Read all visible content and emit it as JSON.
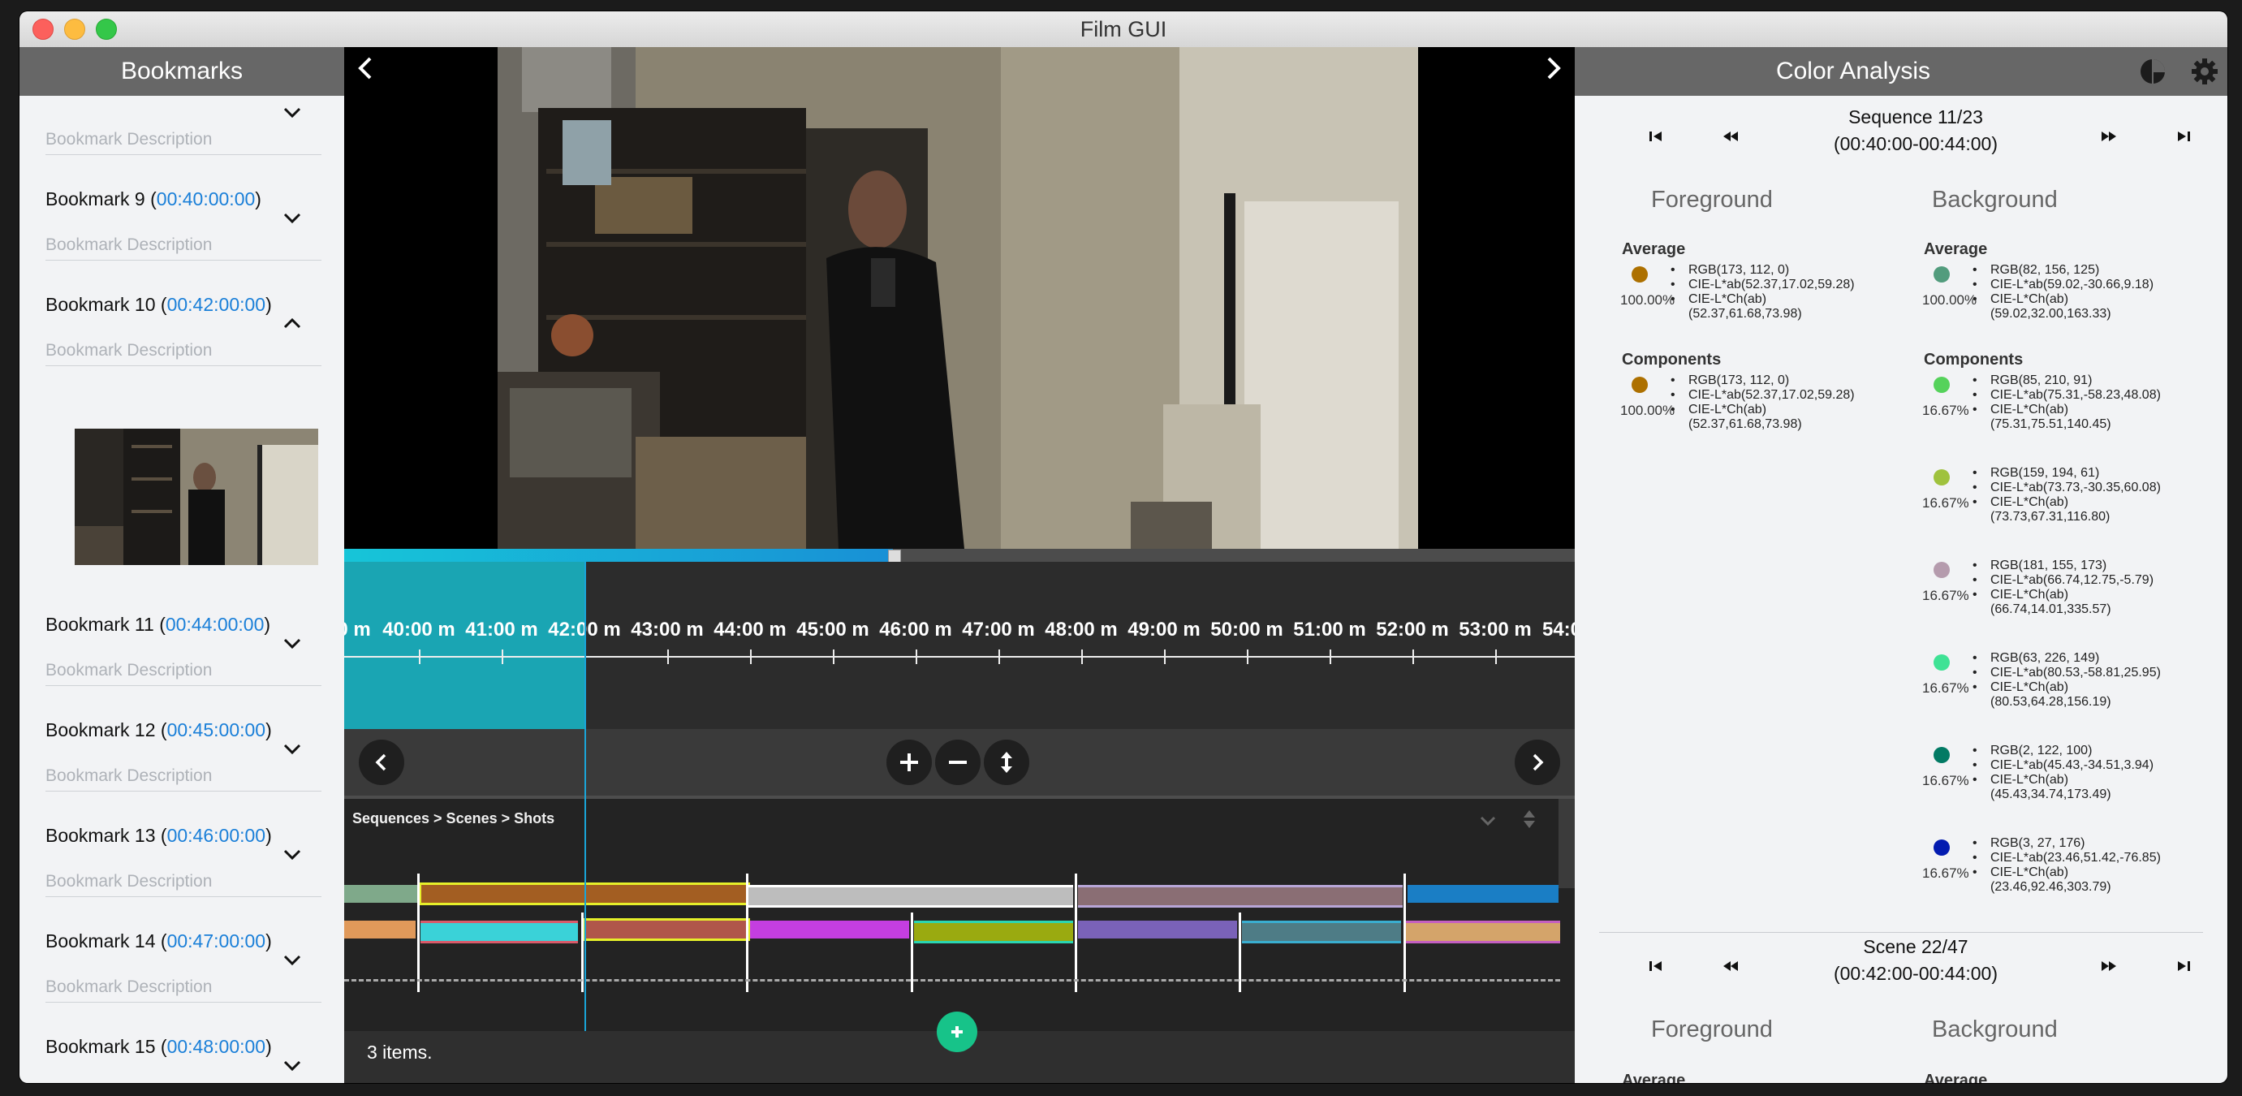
{
  "window": {
    "title": "Film GUI"
  },
  "sidebar": {
    "title": "Bookmarks",
    "desc_placeholder": "Bookmark Description",
    "bookmarks": [
      {
        "name": "Bookmark 9",
        "time": "00:40:00:00"
      },
      {
        "name": "Bookmark 10",
        "time": "00:42:00:00",
        "expanded": true
      },
      {
        "name": "Bookmark 11",
        "time": "00:44:00:00"
      },
      {
        "name": "Bookmark 12",
        "time": "00:45:00:00"
      },
      {
        "name": "Bookmark 13",
        "time": "00:46:00:00"
      },
      {
        "name": "Bookmark 14",
        "time": "00:47:00:00"
      },
      {
        "name": "Bookmark 15",
        "time": "00:48:00:00"
      }
    ]
  },
  "timeline": {
    "labels": [
      "0 m",
      "40:00 m",
      "41:00 m",
      "42:00 m",
      "43:00 m",
      "44:00 m",
      "45:00 m",
      "46:00 m",
      "47:00 m",
      "48:00 m",
      "49:00 m",
      "50:00 m",
      "51:00 m",
      "52:00 m",
      "53:00 m",
      "54:0"
    ]
  },
  "shots": {
    "breadcrumb": "Sequences > Scenes > Shots",
    "status": "3 items."
  },
  "color_analysis": {
    "title": "Color Analysis",
    "sequence": {
      "label": "Sequence 11/23",
      "range": "(00:40:00-00:44:00)"
    },
    "scene": {
      "label": "Scene 22/47",
      "range": "(00:42:00-00:44:00)"
    },
    "foreground_label": "Foreground",
    "background_label": "Background",
    "average_label": "Average",
    "components_label": "Components",
    "foreground": {
      "average": {
        "color": "#ad7000",
        "pct": "100.00%",
        "rgb": "RGB(173, 112, 0)",
        "lab": "CIE-L*ab(52.37,17.02,59.28)",
        "lch": "CIE-L*Ch(ab)",
        "lch_val": "(52.37,61.68,73.98)"
      },
      "components": [
        {
          "color": "#ad7000",
          "pct": "100.00%",
          "rgb": "RGB(173, 112, 0)",
          "lab": "CIE-L*ab(52.37,17.02,59.28)",
          "lch": "CIE-L*Ch(ab)",
          "lch_val": "(52.37,61.68,73.98)"
        }
      ]
    },
    "background": {
      "average": {
        "color": "#529c7d",
        "pct": "100.00%",
        "rgb": "RGB(82, 156, 125)",
        "lab": "CIE-L*ab(59.02,-30.66,9.18)",
        "lch": "CIE-L*Ch(ab)",
        "lch_val": "(59.02,32.00,163.33)"
      },
      "components": [
        {
          "color": "#55d25b",
          "pct": "16.67%",
          "rgb": "RGB(85, 210, 91)",
          "lab": "CIE-L*ab(75.31,-58.23,48.08)",
          "lch": "CIE-L*Ch(ab)",
          "lch_val": "(75.31,75.51,140.45)"
        },
        {
          "color": "#9fc23d",
          "pct": "16.67%",
          "rgb": "RGB(159, 194, 61)",
          "lab": "CIE-L*ab(73.73,-30.35,60.08)",
          "lch": "CIE-L*Ch(ab)",
          "lch_val": "(73.73,67.31,116.80)"
        },
        {
          "color": "#b59bad",
          "pct": "16.67%",
          "rgb": "RGB(181, 155, 173)",
          "lab": "CIE-L*ab(66.74,12.75,-5.79)",
          "lch": "CIE-L*Ch(ab)",
          "lch_val": "(66.74,14.01,335.57)"
        },
        {
          "color": "#3fe295",
          "pct": "16.67%",
          "rgb": "RGB(63, 226, 149)",
          "lab": "CIE-L*ab(80.53,-58.81,25.95)",
          "lch": "CIE-L*Ch(ab)",
          "lch_val": "(80.53,64.28,156.19)"
        },
        {
          "color": "#027a64",
          "pct": "16.67%",
          "rgb": "RGB(2, 122, 100)",
          "lab": "CIE-L*ab(45.43,-34.51,3.94)",
          "lch": "CIE-L*Ch(ab)",
          "lch_val": "(45.43,34.74,173.49)"
        },
        {
          "color": "#031bb0",
          "pct": "16.67%",
          "rgb": "RGB(3, 27, 176)",
          "lab": "CIE-L*ab(23.46,51.42,-76.85)",
          "lch": "CIE-L*Ch(ab)",
          "lch_val": "(23.46,92.46,303.79)"
        }
      ]
    }
  }
}
